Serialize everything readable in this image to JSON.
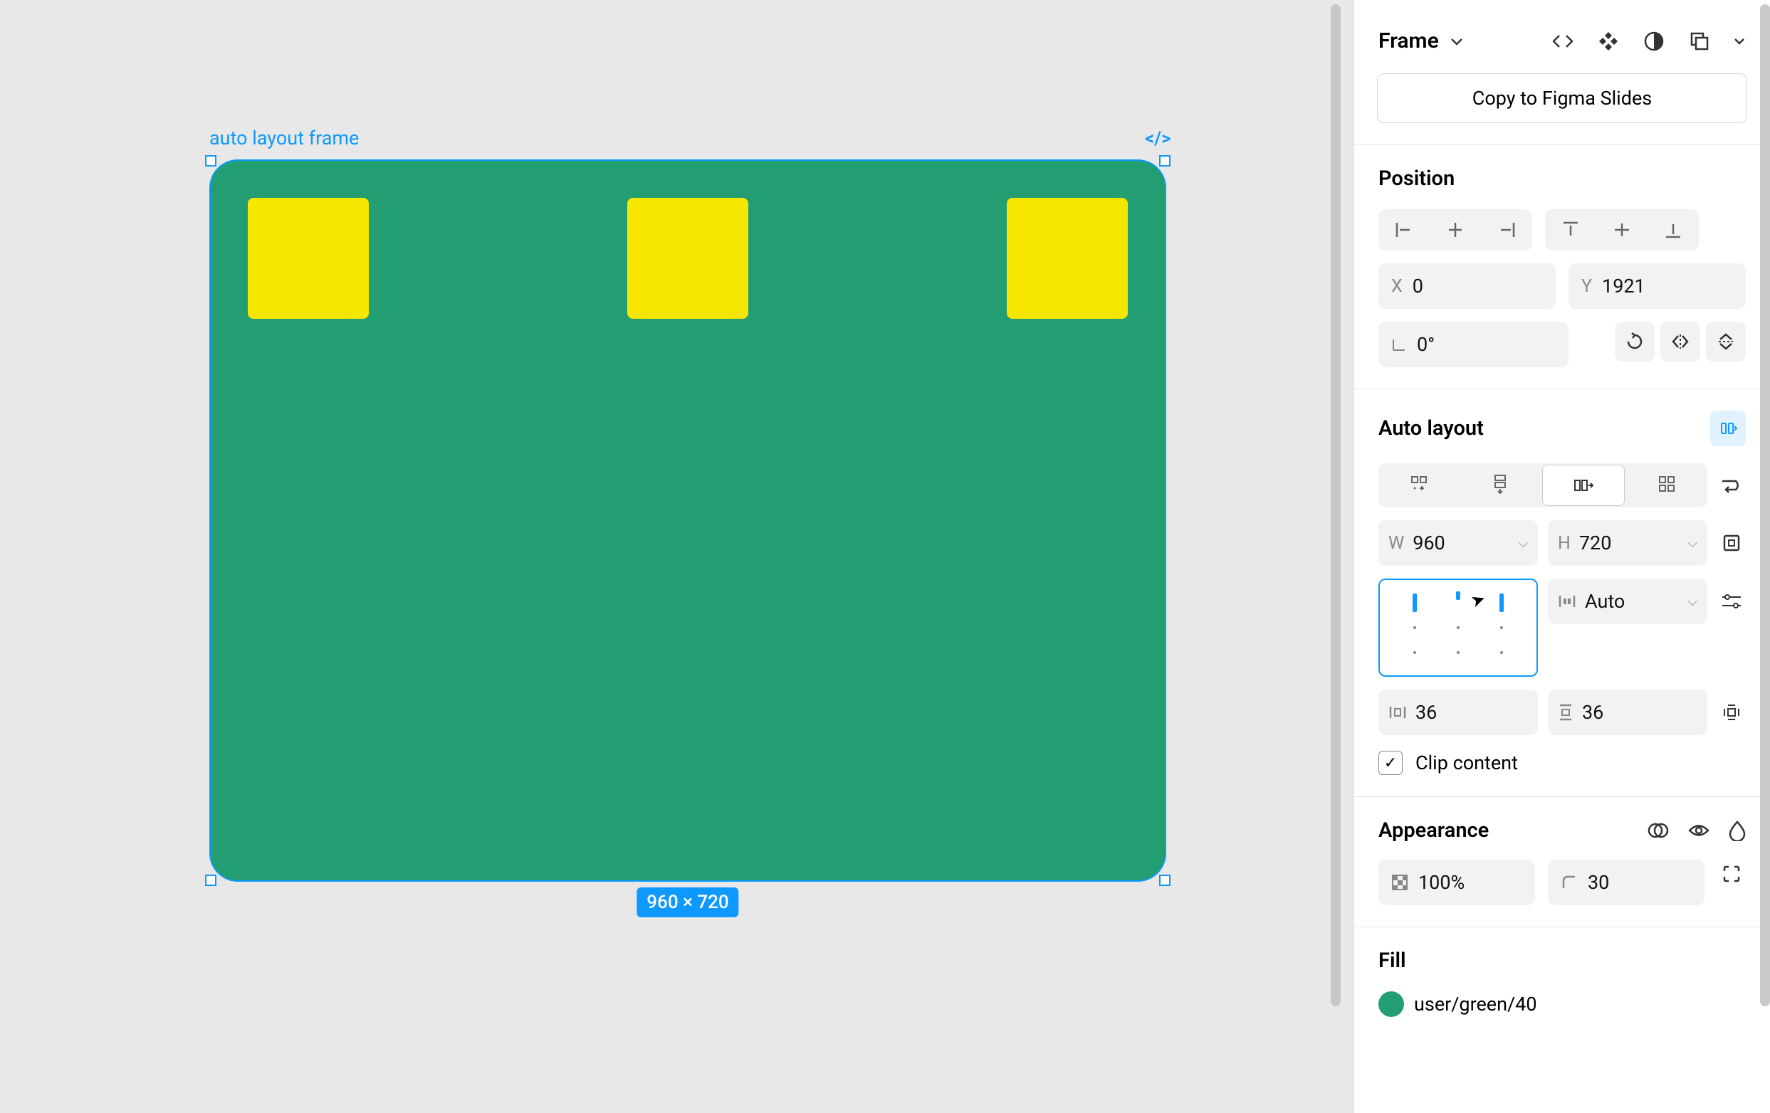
{
  "canvas": {
    "frame_label": "auto layout frame",
    "dimension_badge": "960 × 720"
  },
  "header": {
    "title": "Frame",
    "copy_button": "Copy to Figma Slides"
  },
  "position": {
    "title": "Position",
    "x_label": "X",
    "x_value": "0",
    "y_label": "Y",
    "y_value": "1921",
    "rotation_value": "0°"
  },
  "auto_layout": {
    "title": "Auto layout",
    "w_label": "W",
    "w_value": "960",
    "h_label": "H",
    "h_value": "720",
    "gap_value": "Auto",
    "h_padding": "36",
    "v_padding": "36",
    "clip_content": "Clip content"
  },
  "appearance": {
    "title": "Appearance",
    "opacity": "100%",
    "corner_radius": "30"
  },
  "fill": {
    "title": "Fill",
    "color_name": "user/green/40"
  }
}
